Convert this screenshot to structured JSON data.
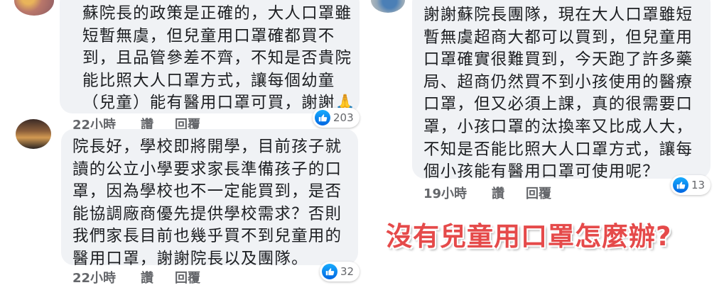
{
  "comments": [
    {
      "lines": [
        "蘇院長的政策是正確的，大人口罩雖",
        "短暫無虞，但兒童用口罩確都買不",
        "到，且品管參差不齊，不知是否貴院",
        "能比照大人口罩方式，讓每個幼童",
        "（兒童）能有醫用口罩可買，謝謝🙏"
      ],
      "time": "22小時",
      "like_label": "讚",
      "reply_label": "回覆",
      "reactions": "203"
    },
    {
      "lines": [
        "院長好，學校即將開學，目前孩子就",
        "讀的公立小學要求家長準備孩子的口",
        "罩，因為學校也不一定能買到，是否",
        "能協調廠商優先提供學校需求？否則",
        "我們家長目前也幾乎買不到兒童用的",
        "醫用口罩，謝謝院長以及團隊。"
      ],
      "time": "22小時",
      "like_label": "讚",
      "reply_label": "回覆",
      "reactions": "32"
    },
    {
      "lines": [
        "謝謝蘇院長團隊，現在大人口罩雖短",
        "暫無虞超商大都可以買到，但兒童用",
        "口罩確實很難買到，今天跑了許多藥",
        "局、超商仍然買不到小孩使用的醫療",
        "口罩，但又必須上課，真的很需要口",
        "罩，小孩口罩的汰換率又比成人大，",
        "不知是否能比照大人口罩方式，讓每",
        "個小孩能有醫用口罩可使用呢？"
      ],
      "time": "19小時",
      "like_label": "讚",
      "reply_label": "回覆",
      "reactions": "13"
    }
  ],
  "headline": "沒有兒童用口罩怎麼辦?",
  "icons": {
    "reaction": "like-thumb-icon"
  },
  "colors": {
    "bubble": "#f0f2f5",
    "meta": "#65676b",
    "headline": "#e54a4a",
    "like": "#0866ff"
  }
}
